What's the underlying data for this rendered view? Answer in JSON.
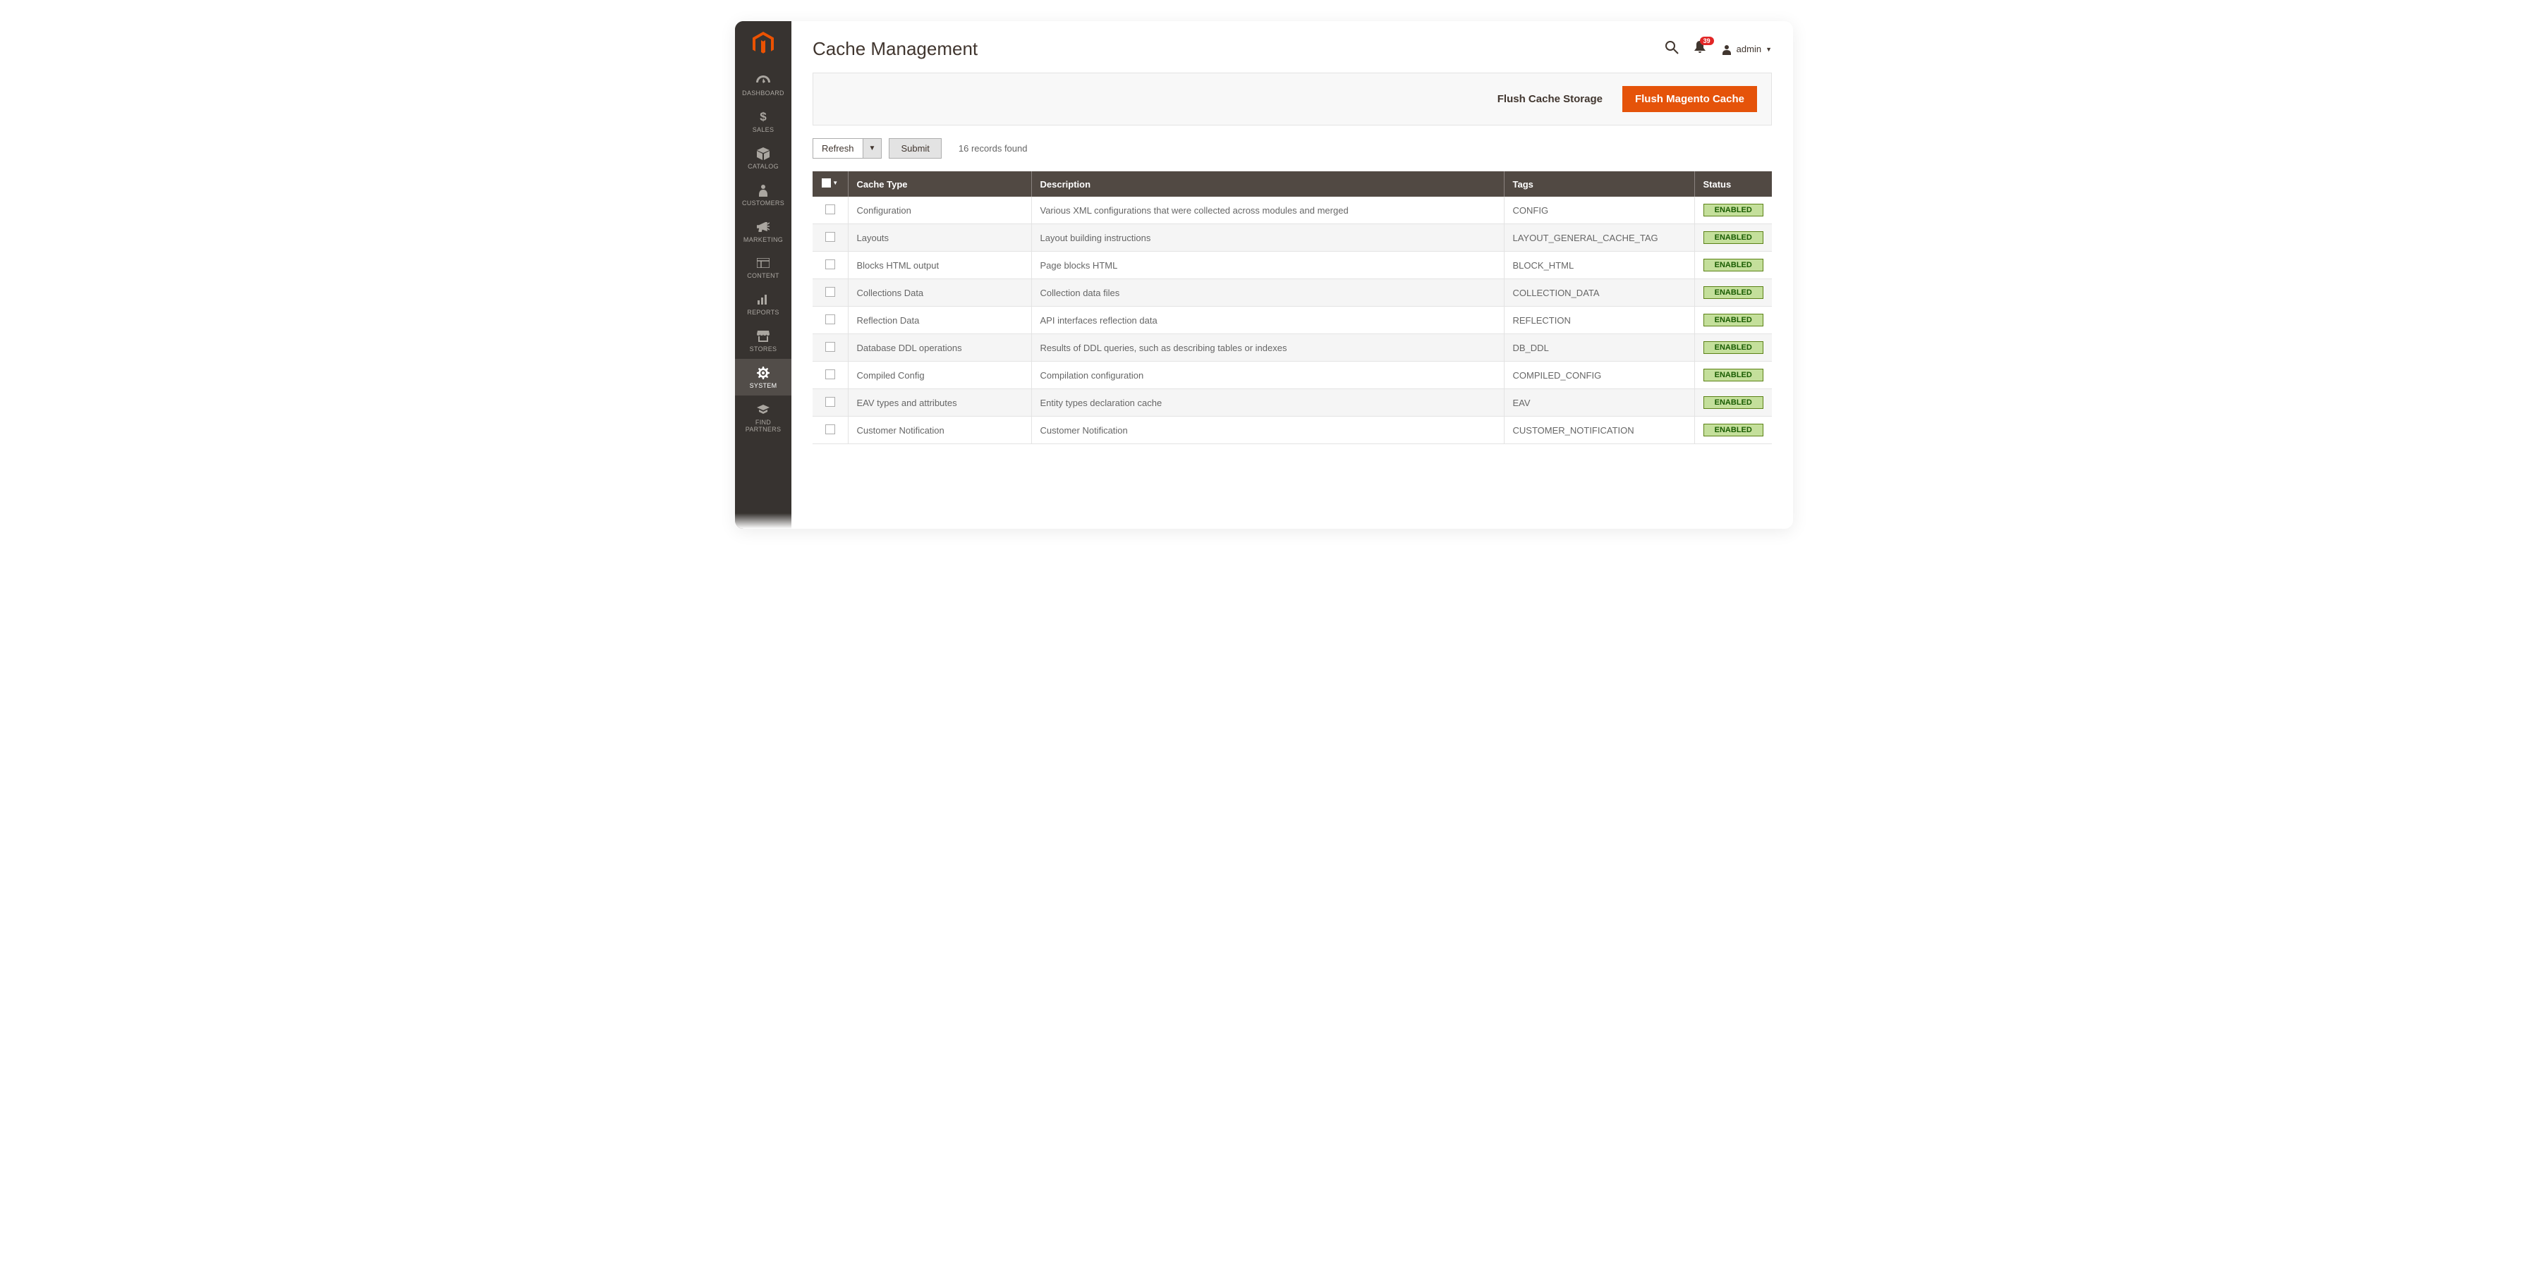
{
  "header": {
    "title": "Cache Management",
    "notification_count": "39",
    "admin_user": "admin"
  },
  "sidebar": {
    "items": [
      {
        "label": "DASHBOARD"
      },
      {
        "label": "SALES"
      },
      {
        "label": "CATALOG"
      },
      {
        "label": "CUSTOMERS"
      },
      {
        "label": "MARKETING"
      },
      {
        "label": "CONTENT"
      },
      {
        "label": "REPORTS"
      },
      {
        "label": "STORES"
      },
      {
        "label": "SYSTEM"
      },
      {
        "label": "FIND PARTNERS"
      }
    ]
  },
  "actions": {
    "flush_storage": "Flush Cache Storage",
    "flush_magento": "Flush Magento Cache"
  },
  "toolbar": {
    "mass_action": "Refresh",
    "submit": "Submit",
    "records": "16 records found"
  },
  "table": {
    "headers": {
      "type": "Cache Type",
      "description": "Description",
      "tags": "Tags",
      "status": "Status"
    },
    "rows": [
      {
        "type": "Configuration",
        "desc": "Various XML configurations that were collected across modules and merged",
        "tags": "CONFIG",
        "status": "ENABLED"
      },
      {
        "type": "Layouts",
        "desc": "Layout building instructions",
        "tags": "LAYOUT_GENERAL_CACHE_TAG",
        "status": "ENABLED"
      },
      {
        "type": "Blocks HTML output",
        "desc": "Page blocks HTML",
        "tags": "BLOCK_HTML",
        "status": "ENABLED"
      },
      {
        "type": "Collections Data",
        "desc": "Collection data files",
        "tags": "COLLECTION_DATA",
        "status": "ENABLED"
      },
      {
        "type": "Reflection Data",
        "desc": "API interfaces reflection data",
        "tags": "REFLECTION",
        "status": "ENABLED"
      },
      {
        "type": "Database DDL operations",
        "desc": "Results of DDL queries, such as describing tables or indexes",
        "tags": "DB_DDL",
        "status": "ENABLED"
      },
      {
        "type": "Compiled Config",
        "desc": "Compilation configuration",
        "tags": "COMPILED_CONFIG",
        "status": "ENABLED"
      },
      {
        "type": "EAV types and attributes",
        "desc": "Entity types declaration cache",
        "tags": "EAV",
        "status": "ENABLED"
      },
      {
        "type": "Customer Notification",
        "desc": "Customer Notification",
        "tags": "CUSTOMER_NOTIFICATION",
        "status": "ENABLED"
      }
    ]
  }
}
